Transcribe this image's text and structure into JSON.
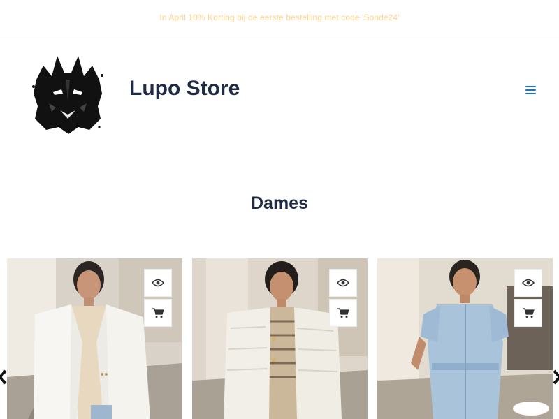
{
  "announcement": "In April 10% Korting bij de eerste bestelling met code 'Sonde24'",
  "header": {
    "brand_name": "Lupo Store",
    "logo_icon": "wolf-logo-icon",
    "menu_icon": "hamburger-menu-icon"
  },
  "section": {
    "title": "Dames"
  },
  "products": [
    {
      "name": "product-1",
      "photo": "woman in white blazer and beige top",
      "actions": [
        "quick-view-icon",
        "add-to-cart-icon"
      ]
    },
    {
      "name": "product-2",
      "photo": "woman in white fringed jacket and striped blouse",
      "actions": [
        "quick-view-icon",
        "add-to-cart-icon"
      ]
    },
    {
      "name": "product-3",
      "photo": "woman in light denim jumpsuit",
      "actions": [
        "quick-view-icon",
        "add-to-cart-icon"
      ]
    }
  ],
  "carousel": {
    "prev_icon": "chevron-left-icon",
    "next_icon": "chevron-right-icon"
  },
  "colors": {
    "brand_text": "#1f2a44",
    "accent": "#1e73be",
    "announcement": "#ffd38a"
  }
}
